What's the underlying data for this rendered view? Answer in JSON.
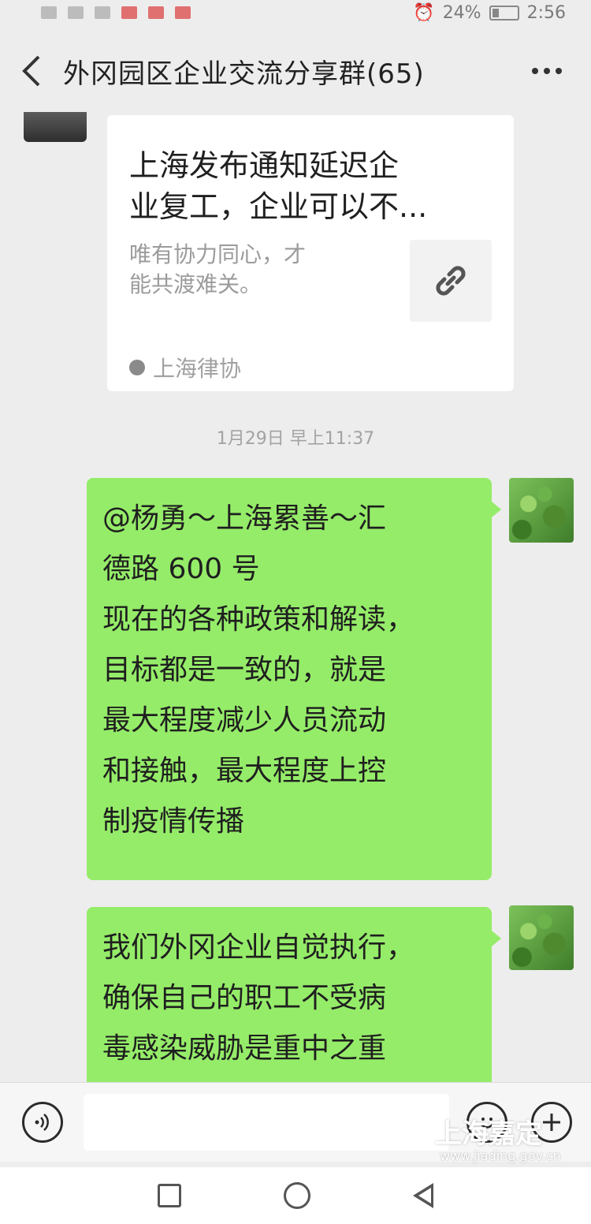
{
  "status_bar": {
    "battery": "24%",
    "time": "2:56"
  },
  "header": {
    "title": "外冈园区企业交流分享群(65)"
  },
  "link_card": {
    "title_line1": "上海发布通知延迟企",
    "title_line2": "业复工，企业可以不...",
    "desc_line1": "唯有协力同心，才",
    "desc_line2": "能共渡难关。",
    "source": "上海律协"
  },
  "timestamp": "1月29日 早上11:37",
  "messages": [
    {
      "lines": [
        "@杨勇～上海累善～汇",
        "德路 600 号",
        "现在的各种政策和解读，",
        "目标都是一致的，就是",
        "最大程度减少人员流动",
        "和接触，最大程度上控",
        "制疫情传播"
      ]
    },
    {
      "lines": [
        "我们外冈企业自觉执行，",
        "确保自己的职工不受病",
        "毒感染威胁是重中之重"
      ]
    }
  ],
  "watermark": {
    "text": "上海嘉定",
    "url": "www.jiading.gov.cn"
  },
  "colors": {
    "bubble": "#95ec69",
    "background": "#ededed"
  },
  "icons": [
    "back-arrow-icon",
    "more-icon",
    "link-icon",
    "voice-icon",
    "emoji-icon",
    "plus-icon",
    "recent-apps-icon",
    "home-icon",
    "back-nav-icon"
  ]
}
